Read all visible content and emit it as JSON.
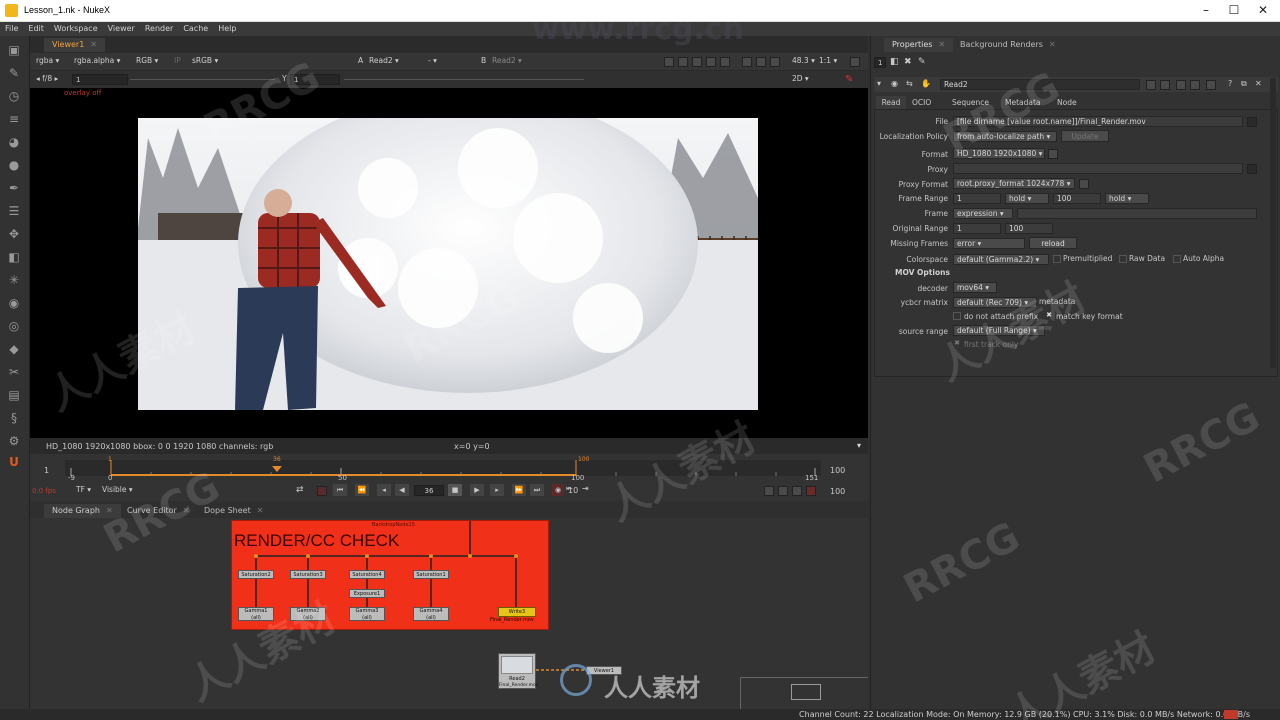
{
  "window": {
    "title": "Lesson_1.nk - NukeX",
    "controls": [
      "–",
      "☐",
      "✕"
    ]
  },
  "menu": [
    "File",
    "Edit",
    "Workspace",
    "Viewer",
    "Render",
    "Cache",
    "Help"
  ],
  "toolbar_icons": [
    "viewer-icon",
    "brush-icon",
    "clock-icon",
    "menu-icon",
    "color-icon",
    "circle-icon",
    "filter-icon",
    "layers-icon",
    "transform-icon",
    "cube-icon",
    "particles-icon",
    "deep-icon",
    "eye-icon",
    "tag-icon",
    "tools-icon",
    "folder-icon",
    "python-icon",
    "gear-icon",
    "nukex-icon"
  ],
  "viewer": {
    "tab": "Viewer1",
    "channels": "rgba",
    "alpha": "rgba.alpha",
    "color": "RGB",
    "ip": "IP",
    "lut": "sRGB",
    "input_a_label": "A",
    "input_a": "Read2",
    "dash": "-",
    "input_b_label": "B",
    "input_b": "Read2",
    "zoom": "48.3",
    "proxy_ratio": "1:1",
    "fstop": "f/8",
    "gain": "1",
    "gamma_label": "Y",
    "gamma": "1",
    "view_mode": "2D",
    "overlay_text": "overlay off",
    "info": "HD_1080 1920x1080  bbox: 0 0 1920 1080 channels: rgb",
    "coords": "x=0 y=0",
    "timeline": {
      "in_frame": "1",
      "out_frame": "100",
      "ticks": [
        "-9",
        "0",
        "50",
        "100",
        "151"
      ],
      "marker_in": "1",
      "marker_current": "36",
      "marker_out": "100",
      "fps": "0.0 fps",
      "tf": "TF",
      "visible": "Visible",
      "current_frame": "36",
      "increment": "10",
      "end_field": "100"
    }
  },
  "node_panel": {
    "tabs": [
      "Node Graph",
      "Curve Editor",
      "Dope Sheet"
    ],
    "backdrop_small_label": "BackdropNode15",
    "backdrop_title": "RENDER/CC CHECK",
    "saturation_nodes": [
      "Saturation2",
      "Saturation3",
      "Saturation4",
      "Saturation1"
    ],
    "exposure_node": "Exposure1",
    "gamma_nodes": [
      "Gamma1",
      "Gamma2",
      "Gamma3",
      "Gamma4"
    ],
    "gamma_sub": "(all)",
    "write_node": "Write3",
    "write_sub": "Final_Render.mov",
    "read_node": "Read2",
    "read_sub": "Final_Render.mov",
    "viewer_node": "Viewer1"
  },
  "properties": {
    "tabs": [
      "Properties",
      "Background Renders"
    ],
    "node_name": "Read2",
    "sub_tabs": [
      "Read",
      "OCIO",
      "Sequence",
      "Metadata",
      "Node"
    ],
    "file_label": "File",
    "file_value": "[file dirname [value root.name]]/Final_Render.mov",
    "localization_label": "Localization Policy",
    "localization_value": "from auto-localize path",
    "update_btn": "Update",
    "format_label": "Format",
    "format_value": "HD_1080 1920x1080",
    "proxy_label": "Proxy",
    "proxy_format_label": "Proxy Format",
    "proxy_format_value": "root.proxy_format 1024x778",
    "frame_range_label": "Frame Range",
    "frame_start": "1",
    "frame_before": "hold",
    "frame_end": "100",
    "frame_after": "hold",
    "frame_label": "Frame",
    "frame_mode": "expression",
    "original_range_label": "Original Range",
    "original_start": "1",
    "original_end": "100",
    "missing_label": "Missing Frames",
    "missing_value": "error",
    "reload_btn": "reload",
    "colorspace_label": "Colorspace",
    "colorspace_value": "default (Gamma2.2)",
    "premult": "Premultiplied",
    "raw": "Raw Data",
    "auto_alpha": "Auto Alpha",
    "mov_header": "MOV Options",
    "decoder_label": "decoder",
    "decoder_value": "mov64",
    "ycbcr_label": "ycbcr matrix",
    "ycbcr_value": "default (Rec 709)",
    "metadata_label": "metadata",
    "no_prefix": "do not attach prefix",
    "match_key": "match key format",
    "source_range_label": "source range",
    "source_range_value": "default (Full Range)",
    "first_track": "first track only"
  },
  "status": "Channel Count: 22  Localization Mode: On  Memory: 12.9 GB (20.1%)  CPU: 3.1%  Disk: 0.0 MB/s  Network: 0.0 MB/s",
  "watermark": "www.rrcg.cn",
  "watermark_tags": [
    "RRCG",
    "人人素材"
  ],
  "logo_text": "人人素材"
}
